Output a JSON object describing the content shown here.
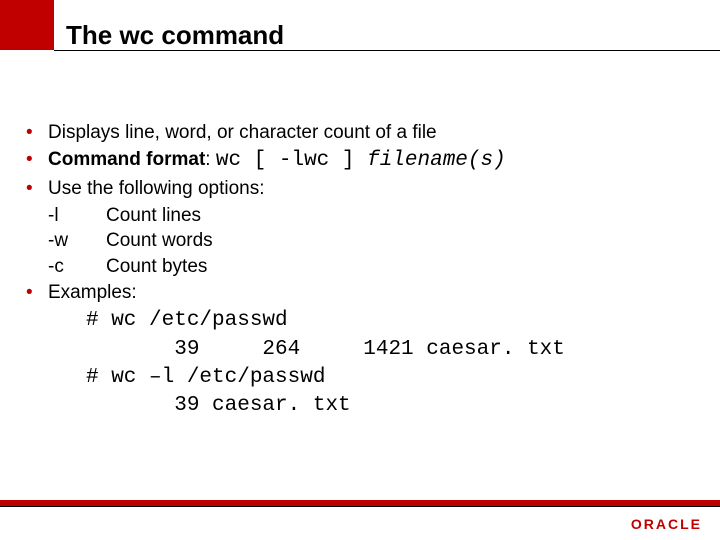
{
  "title": "The wc command",
  "bullets": {
    "b1": "Displays  line, word, or character count of a file",
    "b2_label": "Command format",
    "b2_colon": ": ",
    "b2_cmd": "wc [ -lwc ] ",
    "b2_arg": "filename(s)",
    "b3": "Use the following options:",
    "b4": "Examples:"
  },
  "options": [
    {
      "flag": "-l",
      "desc": "Count lines"
    },
    {
      "flag": "-w",
      "desc": "Count words"
    },
    {
      "flag": "-c",
      "desc": "Count bytes"
    }
  ],
  "examples_text": "# wc /etc/passwd\n       39     264     1421 caesar. txt\n# wc –l /etc/passwd\n       39 caesar. txt",
  "logo": "ORACLE",
  "chart_data": null
}
